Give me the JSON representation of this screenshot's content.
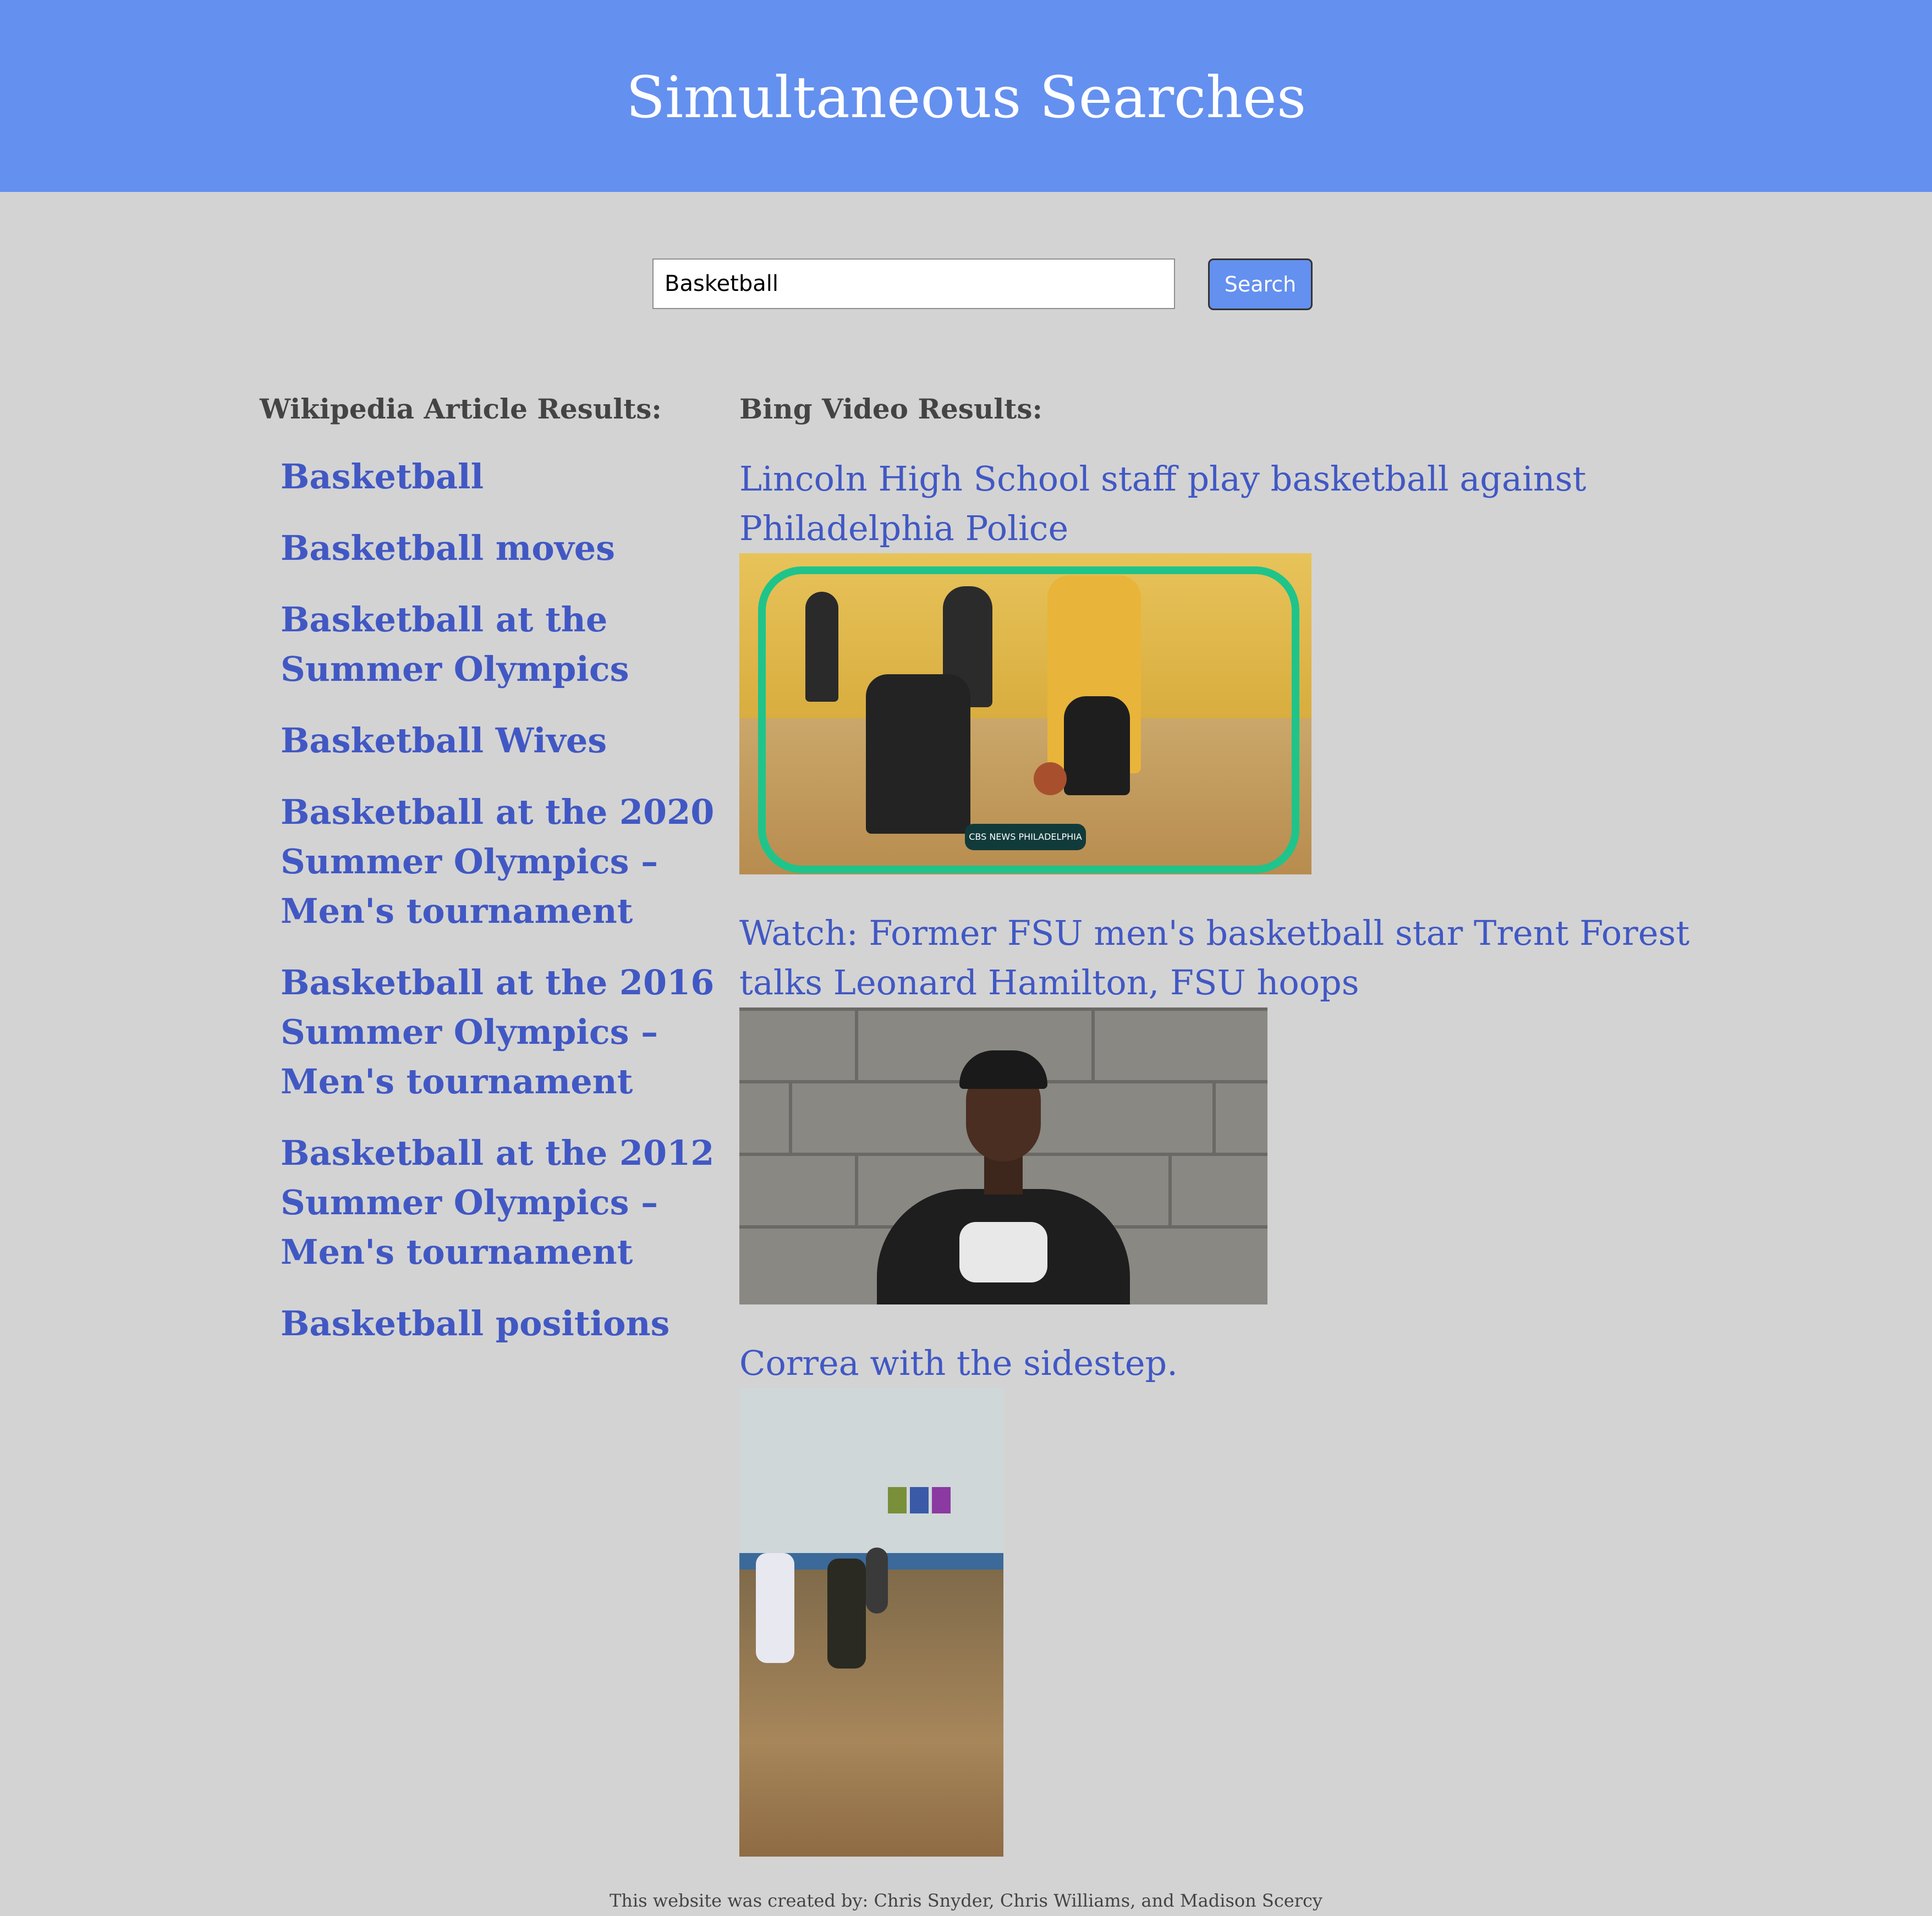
{
  "header": {
    "title": "Simultaneous Searches"
  },
  "search": {
    "value": "Basketball",
    "button_label": "Search"
  },
  "wikipedia": {
    "heading": "Wikipedia Article Results:",
    "results": [
      "Basketball",
      "Basketball moves",
      "Basketball at the Summer Olympics",
      "Basketball Wives",
      "Basketball at the 2020 Summer Olympics – Men's tournament",
      "Basketball at the 2016 Summer Olympics – Men's tournament",
      "Basketball at the 2012 Summer Olympics – Men's tournament",
      "Basketball positions"
    ]
  },
  "bing": {
    "heading": "Bing Video Results:",
    "videos": [
      {
        "title": "Lincoln High School staff play basketball against Philadelphia Police",
        "thumbnail_logo": "CBS NEWS PHILADELPHIA"
      },
      {
        "title": "Watch: Former FSU men's basketball star Trent Forest talks Leonard Hamilton, FSU hoops"
      },
      {
        "title": "Correa with the sidestep."
      }
    ]
  },
  "footer": {
    "credit": "This website was created by: Chris Snyder, Chris Williams, and Madison Scercy"
  },
  "colors": {
    "header_bg": "#6490ef",
    "page_bg": "#d3d3d3",
    "link": "#4158c4",
    "heading_text": "#444444"
  }
}
